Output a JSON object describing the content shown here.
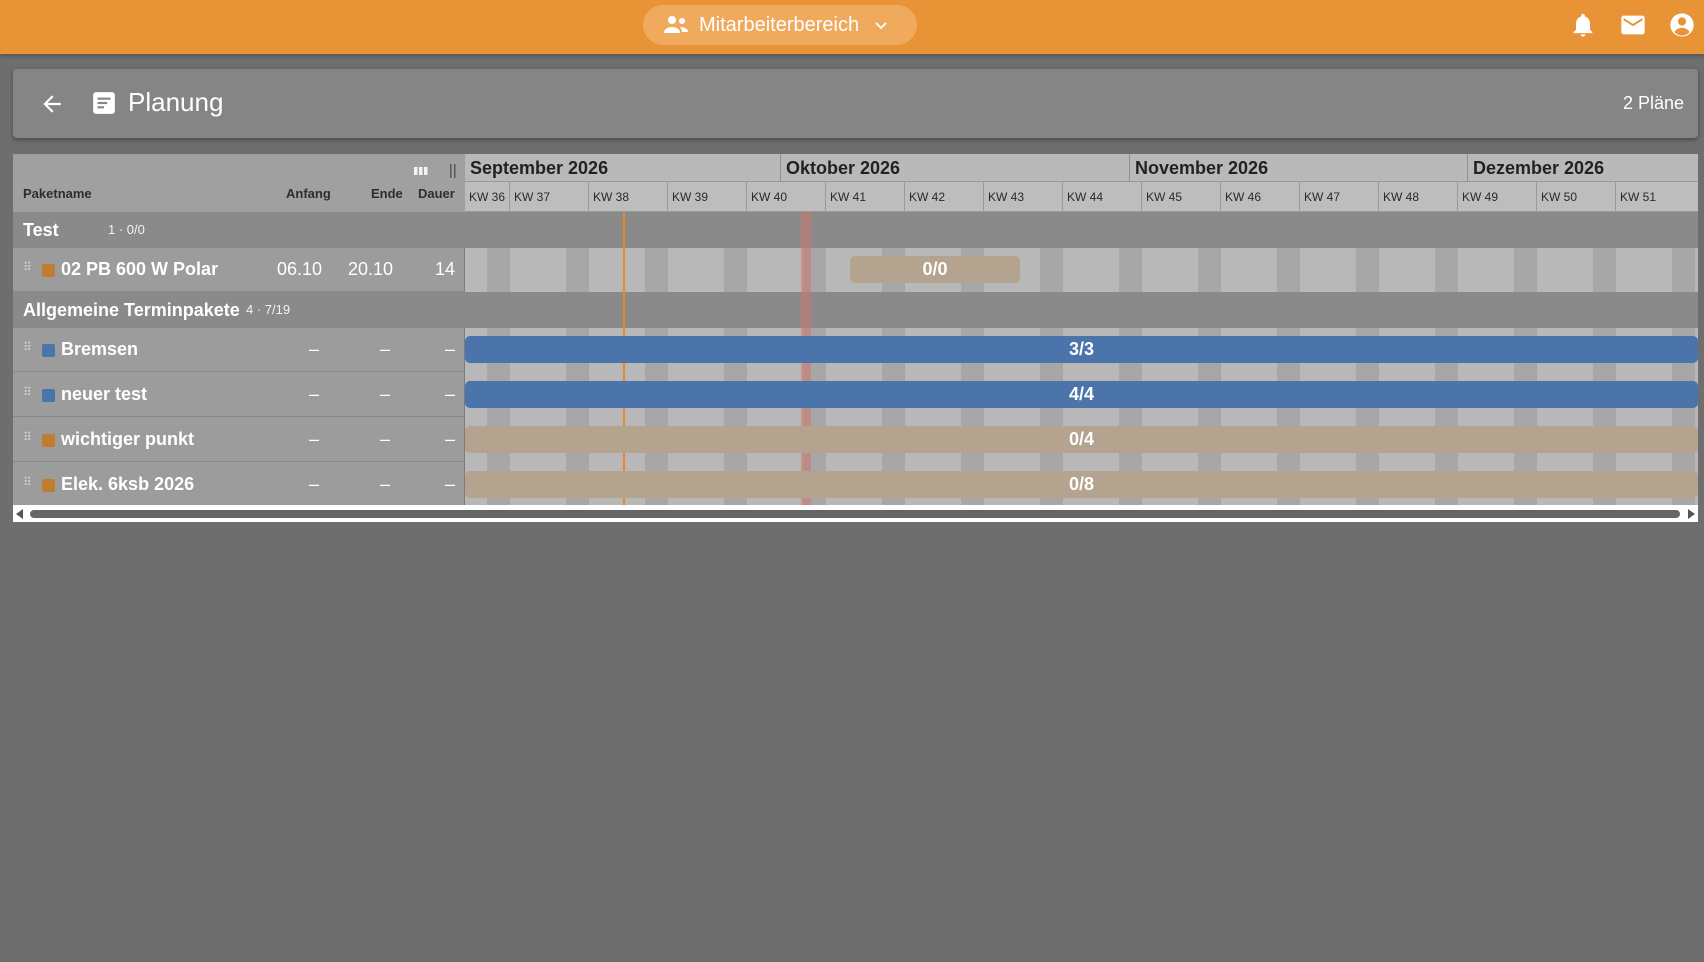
{
  "topbar": {
    "area_label": "Mitarbeiterbereich",
    "icons": [
      "people-icon",
      "chevron-down-icon",
      "bell-icon",
      "mail-icon",
      "account-icon"
    ]
  },
  "header": {
    "title": "Planung",
    "plan_count": "2 Pläne"
  },
  "columns": {
    "name": "Paketname",
    "start": "Anfang",
    "end": "Ende",
    "duration": "Dauer"
  },
  "timeline": {
    "months": [
      "September 2026",
      "Oktober 2026",
      "November 2026",
      "Dezember 2026"
    ],
    "weeks": [
      "KW 36",
      "KW 37",
      "KW 38",
      "KW 39",
      "KW 40",
      "KW 41",
      "KW 42",
      "KW 43",
      "KW 44",
      "KW 45",
      "KW 46",
      "KW 47",
      "KW 48",
      "KW 49",
      "KW 50",
      "KW 51"
    ]
  },
  "groups": [
    {
      "name": "Test",
      "meta": "1 · 0/0",
      "tasks": [
        {
          "name": "02 PB 600 W Polar",
          "color": "#c07d32",
          "start": "06.10",
          "end": "20.10",
          "duration": "14",
          "progress": "0/0"
        }
      ]
    },
    {
      "name": "Allgemeine Terminpakete",
      "meta": "4 · 7/19",
      "tasks": [
        {
          "name": "Bremsen",
          "color": "#4a74aa",
          "start": "–",
          "end": "–",
          "duration": "–",
          "progress": "3/3"
        },
        {
          "name": "neuer test",
          "color": "#4a74aa",
          "start": "–",
          "end": "–",
          "duration": "–",
          "progress": "4/4"
        },
        {
          "name": "wichtiger punkt",
          "color": "#c07d32",
          "start": "–",
          "end": "–",
          "duration": "–",
          "progress": "0/4"
        },
        {
          "name": "Elek. 6ksb 2026",
          "color": "#c07d32",
          "start": "–",
          "end": "–",
          "duration": "–",
          "progress": "0/8"
        }
      ]
    }
  ],
  "colors": {
    "accent": "#e89335",
    "bar_done": "#4a74aa",
    "bar_open": "#b4a38e",
    "today_line": "#e8892a"
  }
}
